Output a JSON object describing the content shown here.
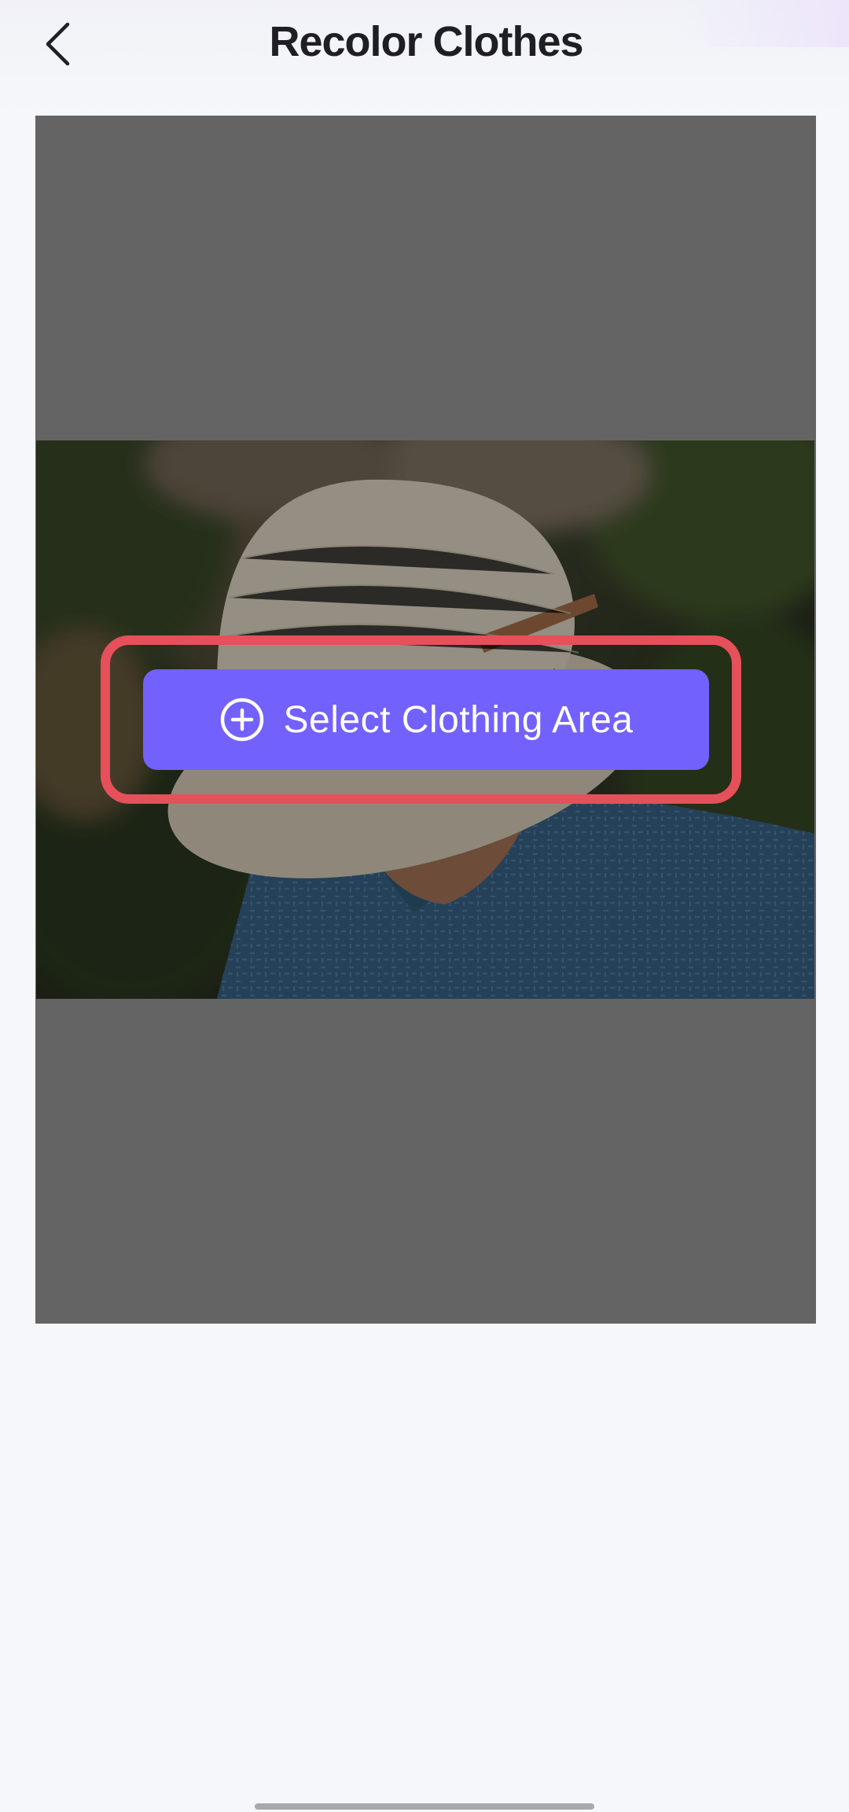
{
  "header": {
    "title": "Recolor Clothes",
    "back_icon": "chevron-left-icon"
  },
  "canvas": {
    "background_color": "#646464",
    "select_button": {
      "label": "Select Clothing Area",
      "icon": "plus-circle-icon",
      "color": "#7361fd",
      "highlight_color": "#e5505a"
    }
  },
  "colors": {
    "page_background": "#f6f7fa",
    "title_text": "#1e1e24"
  }
}
